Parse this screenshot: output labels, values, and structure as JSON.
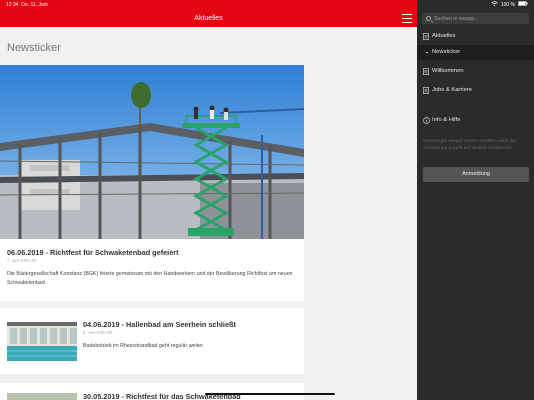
{
  "status_bar": {
    "time": "12:34",
    "date": "Do. 11. Juni",
    "battery": "100 %"
  },
  "app_bar": {
    "title": "Aktuelles"
  },
  "page": {
    "heading": "Newsticker"
  },
  "news": [
    {
      "title": "06.06.2019 - Richtfest für Schwaketenbad gefeiert",
      "meta": "7. Juni 9:08 Uhr",
      "body": "Die Bädergesellschaft Konstanz (BGK) feierte gemeinsam mit den Handwerkern und der Bevölkerung Richtfest am neuen Schwaketenbad."
    },
    {
      "title": "04.06.2019 - Hallenbad am Seerhein schließt",
      "meta": "5. Juni 9:08 Uhr",
      "body": "Badebetrieb im Rheinstrandbad geht regulär weiter."
    },
    {
      "title": "30.05.2019 - Richtfest für das Schwaketenbad"
    }
  ],
  "sidebar": {
    "search_placeholder": "Suchen in swapp...",
    "items": [
      {
        "label": "Aktuelles",
        "icon": "document-icon"
      },
      {
        "label": "Newsticker"
      },
      {
        "label": "Willkommen",
        "icon": "document-icon"
      },
      {
        "label": "Jobs & Karriere",
        "icon": "document-icon"
      },
      {
        "label": "Info & Hilfe",
        "icon": "info-icon"
      }
    ],
    "note": "Berechtigte swapp-Nutzer erhalten nach der Anmeldung Zugriff auf weitere Funktionen.",
    "login_label": "Anmeldung"
  },
  "colors": {
    "brand_red": "#e30613",
    "sidebar_bg": "#2b2b2b",
    "content_bg": "#f1f1f1"
  }
}
